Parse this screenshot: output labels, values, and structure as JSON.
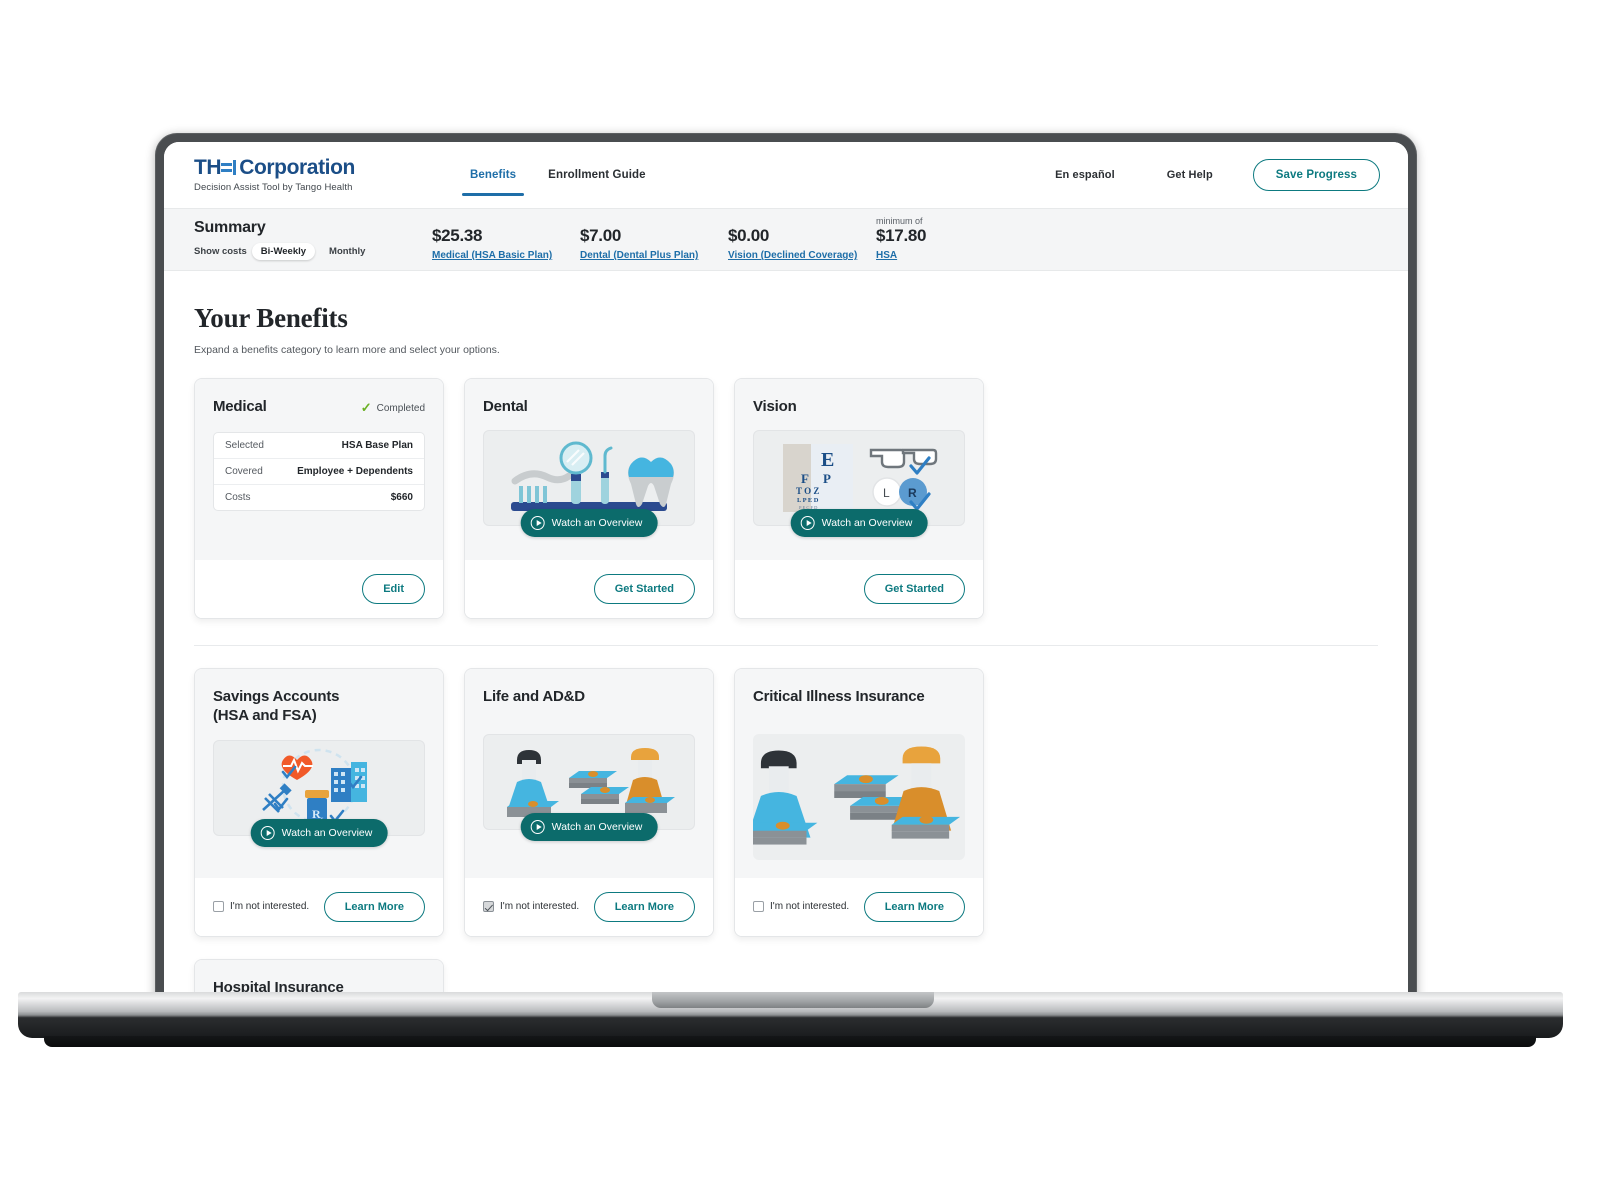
{
  "brand": {
    "logo_prefix": "TH",
    "logo_glyph_icon": "stylized-e-bracket-icon",
    "logo_suffix": "Corporation",
    "tagline": "Decision Assist Tool by Tango Health"
  },
  "nav": {
    "links": [
      {
        "label": "Benefits",
        "active": true
      },
      {
        "label": "Enrollment Guide",
        "active": false
      }
    ],
    "right_links": [
      {
        "label": "En español"
      },
      {
        "label": "Get Help"
      }
    ],
    "save_progress_label": "Save Progress"
  },
  "summary": {
    "title": "Summary",
    "show_costs_label": "Show costs",
    "frequency_options": [
      {
        "label": "Bi-Weekly",
        "selected": true
      },
      {
        "label": "Monthly",
        "selected": false
      }
    ],
    "items": [
      {
        "amount": "$25.38",
        "link": "Medical (HSA Basic Plan)",
        "prefix": ""
      },
      {
        "amount": "$7.00",
        "link": "Dental (Dental Plus Plan)",
        "prefix": ""
      },
      {
        "amount": "$0.00",
        "link": "Vision (Declined Coverage)",
        "prefix": ""
      },
      {
        "amount": "$17.80",
        "link": "HSA",
        "prefix": "minimum of"
      }
    ]
  },
  "main": {
    "title": "Your Benefits",
    "subtitle": "Expand a benefits category to learn more and select your options."
  },
  "cards": {
    "medical": {
      "title": "Medical",
      "status_label": "Completed",
      "status_icon": "green-check-icon",
      "details": [
        {
          "key": "Selected",
          "value": "HSA Base Plan"
        },
        {
          "key": "Covered",
          "value": "Employee + Dependents"
        },
        {
          "key": "Costs",
          "value": "$660"
        }
      ],
      "action_label": "Edit"
    },
    "dental": {
      "title": "Dental",
      "illustration_icon": "dental-tools-tooth-illustration",
      "watch_label": "Watch an Overview",
      "action_label": "Get Started"
    },
    "vision": {
      "title": "Vision",
      "illustration_icon": "eye-chart-glasses-illustration",
      "watch_label": "Watch an Overview",
      "action_label": "Get Started"
    },
    "savings": {
      "title": "Savings Accounts (HSA and FSA)",
      "title_line1": "Savings Accounts",
      "title_line2": "(HSA and FSA)",
      "illustration_icon": "heart-building-prescription-illustration",
      "watch_label": "Watch an Overview",
      "not_interested_label": "I'm not interested.",
      "not_interested_checked": false,
      "action_label": "Learn More"
    },
    "life": {
      "title": "Life and AD&D",
      "illustration_icon": "people-money-stacks-illustration",
      "watch_label": "Watch an Overview",
      "not_interested_label": "I'm not interested.",
      "not_interested_checked": true,
      "action_label": "Learn More"
    },
    "critical": {
      "title": "Critical Illness Insurance",
      "illustration_icon": "people-money-stacks-illustration",
      "not_interested_label": "I'm not interested.",
      "not_interested_checked": false,
      "action_label": "Learn More"
    },
    "hospital": {
      "title": "Hospital Insurance"
    }
  },
  "colors": {
    "brand_blue": "#1b4e87",
    "accent_teal": "#0d7a80",
    "link_blue": "#1e6ea8",
    "success_green": "#6ab023",
    "watch_teal": "#0c6b6b"
  }
}
